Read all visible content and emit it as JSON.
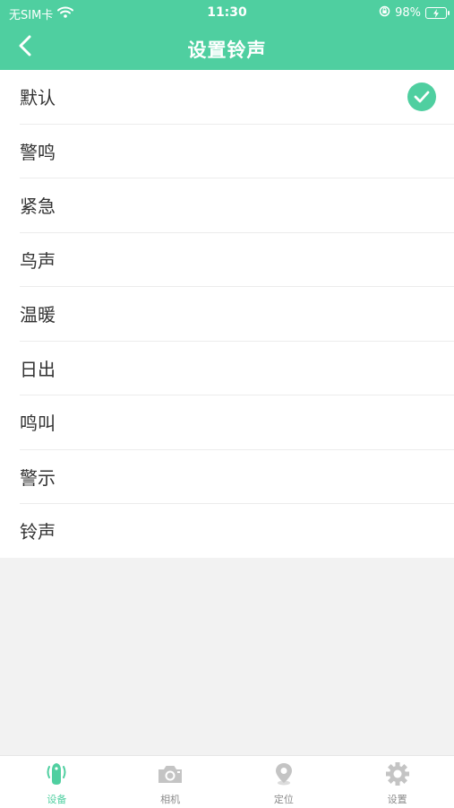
{
  "status_bar": {
    "carrier": "无SIM卡",
    "time": "11:30",
    "battery": "98%"
  },
  "nav": {
    "title": "设置铃声",
    "back_icon": "chevron-left-icon"
  },
  "ringtones": [
    {
      "label": "默认",
      "selected": true
    },
    {
      "label": "警鸣",
      "selected": false
    },
    {
      "label": "紧急",
      "selected": false
    },
    {
      "label": "鸟声",
      "selected": false
    },
    {
      "label": "温暖",
      "selected": false
    },
    {
      "label": "日出",
      "selected": false
    },
    {
      "label": "鸣叫",
      "selected": false
    },
    {
      "label": "警示",
      "selected": false
    },
    {
      "label": "铃声",
      "selected": false
    }
  ],
  "tabbar": {
    "items": [
      {
        "label": "设备",
        "icon": "device-icon",
        "active": true
      },
      {
        "label": "相机",
        "icon": "camera-icon",
        "active": false
      },
      {
        "label": "定位",
        "icon": "location-pin-icon",
        "active": false
      },
      {
        "label": "设置",
        "icon": "gear-icon",
        "active": false
      }
    ]
  },
  "colors": {
    "accent": "#4fcfa0",
    "background": "#f2f2f2",
    "inactive": "#c4c4c4"
  }
}
